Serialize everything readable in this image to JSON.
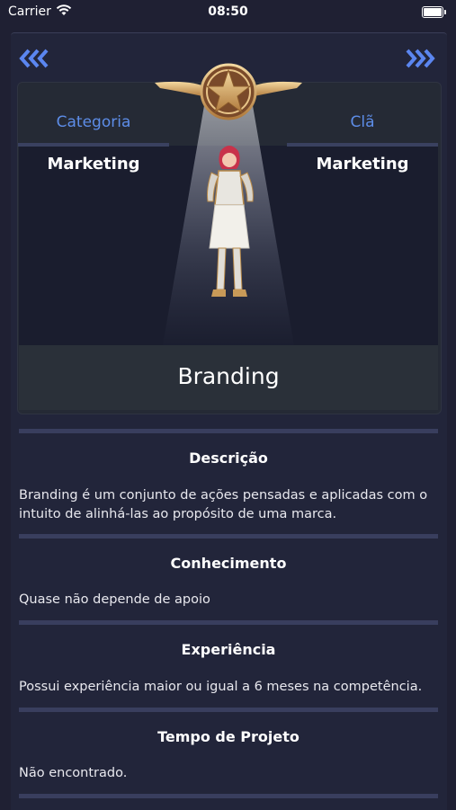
{
  "status_bar": {
    "carrier": "Carrier",
    "time": "08:50"
  },
  "nav": {
    "prev_icon": "double-chevron-left-icon",
    "next_icon": "double-chevron-right-icon",
    "accent_color": "#5b86f0"
  },
  "hero": {
    "category_label": "Categoria",
    "category_value": "Marketing",
    "clan_label": "Clã",
    "clan_value": "Marketing",
    "badge_icon": "winged-star-badge-icon",
    "character_icon": "armored-heroine-character",
    "title": "Branding"
  },
  "sections": [
    {
      "title": "Descrição",
      "body": "Branding é um conjunto de ações pensadas e aplicadas com o intuito de alinhá-las ao propósito de uma marca."
    },
    {
      "title": "Conhecimento",
      "body": "Quase não depende de apoio"
    },
    {
      "title": "Experiência",
      "body": "Possui experiência maior ou igual a 6 meses na competência."
    },
    {
      "title": "Tempo de Projeto",
      "body": "Não encontrado."
    }
  ],
  "colors": {
    "background": "#1f2033",
    "panel": "#22253a",
    "tab_text": "#5d8de8",
    "divider": "#393e5e"
  }
}
